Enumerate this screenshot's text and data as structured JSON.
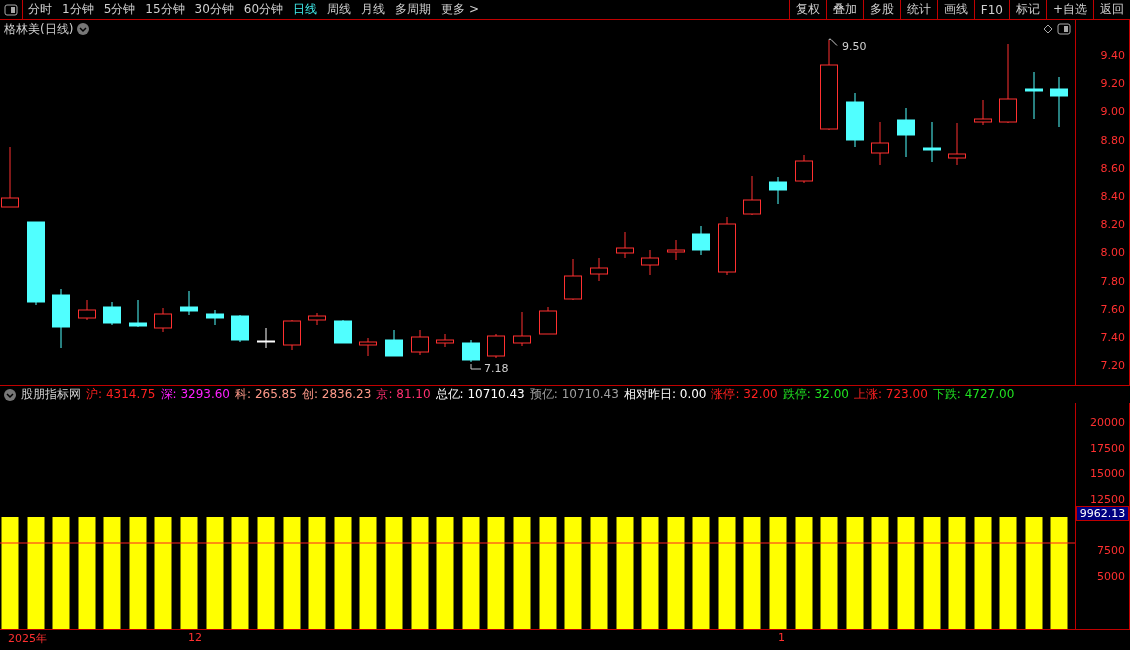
{
  "toolbar": {
    "periods": [
      {
        "label": "分时",
        "selected": false
      },
      {
        "label": "1分钟",
        "selected": false
      },
      {
        "label": "5分钟",
        "selected": false
      },
      {
        "label": "15分钟",
        "selected": false
      },
      {
        "label": "30分钟",
        "selected": false
      },
      {
        "label": "60分钟",
        "selected": false
      },
      {
        "label": "日线",
        "selected": true
      },
      {
        "label": "周线",
        "selected": false
      },
      {
        "label": "月线",
        "selected": false
      },
      {
        "label": "多周期",
        "selected": false
      },
      {
        "label": "更多 >",
        "selected": false
      }
    ],
    "actions": [
      "复权",
      "叠加",
      "多股",
      "统计",
      "画线",
      "F10",
      "标记",
      "+自选",
      "返回"
    ]
  },
  "chart": {
    "title": "格林美(日线)",
    "high_label": "9.50",
    "low_label": "7.18",
    "price_ticks": [
      "9.40",
      "9.20",
      "9.00",
      "8.80",
      "8.60",
      "8.40",
      "8.20",
      "8.00",
      "7.80",
      "7.60",
      "7.40",
      "7.20"
    ]
  },
  "indicator": {
    "name": "股朋指标网",
    "stats": [
      {
        "label": "沪:",
        "value": "4314.75",
        "color": "#ff2020"
      },
      {
        "label": "深:",
        "value": "3293.60",
        "color": "#ff20ff"
      },
      {
        "label": "科:",
        "value": "265.85",
        "color": "#ff9a8a"
      },
      {
        "label": "创:",
        "value": "2836.23",
        "color": "#ff9a8a"
      },
      {
        "label": "京:",
        "value": "81.10",
        "color": "#ff3070"
      },
      {
        "label": "总亿:",
        "value": "10710.43",
        "color": "#ffffff"
      },
      {
        "label": "预亿:",
        "value": "10710.43",
        "color": "#a0a0a0"
      },
      {
        "label": "相对昨日:",
        "value": "0.00",
        "color": "#ffffff"
      },
      {
        "label": "涨停:",
        "value": "32.00",
        "color": "#ff2020"
      },
      {
        "label": "跌停:",
        "value": "32.00",
        "color": "#20e020"
      },
      {
        "label": "上涨:",
        "value": "723.00",
        "color": "#ff2020"
      },
      {
        "label": "下跌:",
        "value": "4727.00",
        "color": "#20e020"
      }
    ],
    "volume_ticks": [
      "20000",
      "17500",
      "15000",
      "12500",
      "7500",
      "5000"
    ],
    "current_value": "9962.13"
  },
  "time_axis": [
    "2025年",
    "12",
    "1"
  ]
}
